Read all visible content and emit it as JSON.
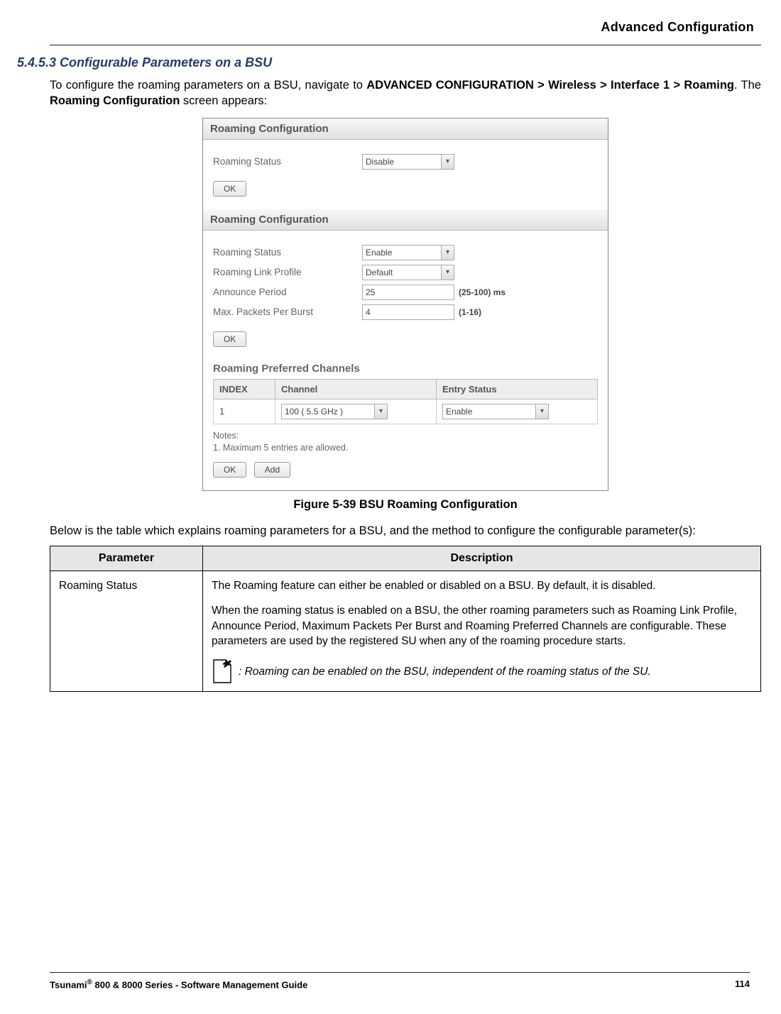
{
  "header": {
    "right": "Advanced Configuration"
  },
  "section": {
    "heading": "5.4.5.3 Configurable Parameters on a BSU"
  },
  "intro": {
    "pre": "To configure the roaming parameters on a BSU, navigate to ",
    "path": "ADVANCED CONFIGURATION > Wireless > Interface 1 > Roaming",
    "mid": ". The ",
    "screen": "Roaming Configuration",
    "post": " screen appears:"
  },
  "ui": {
    "panel1": {
      "title": "Roaming Configuration",
      "roamingStatusLabel": "Roaming Status",
      "roamingStatusValue": "Disable",
      "ok": "OK"
    },
    "panel2": {
      "title": "Roaming Configuration",
      "rows": {
        "roamingStatus": {
          "label": "Roaming Status",
          "value": "Enable"
        },
        "linkProfile": {
          "label": "Roaming Link Profile",
          "value": "Default"
        },
        "announce": {
          "label": "Announce Period",
          "value": "25",
          "hint": "(25-100) ms"
        },
        "maxPackets": {
          "label": "Max. Packets Per Burst",
          "value": "4",
          "hint": "(1-16)"
        }
      },
      "ok": "OK",
      "preferred": {
        "title": "Roaming Preferred Channels",
        "headers": {
          "index": "INDEX",
          "channel": "Channel",
          "entry": "Entry Status"
        },
        "row": {
          "index": "1",
          "channel": "100 ( 5.5 GHz )",
          "entry": "Enable"
        },
        "notesTitle": "Notes:",
        "note1": "1. Maximum 5 entries are allowed.",
        "ok": "OK",
        "add": "Add"
      }
    }
  },
  "figcap": "Figure 5-39 BSU Roaming Configuration",
  "tableIntro": "Below is the table which explains roaming parameters for a BSU, and the method to configure the configurable parameter(s):",
  "paramTable": {
    "headers": {
      "param": "Parameter",
      "desc": "Description"
    },
    "row1": {
      "param": "Roaming Status",
      "p1": "The Roaming feature can either be enabled or disabled on a BSU. By default, it is disabled.",
      "p2": "When the roaming status is enabled on a BSU, the other roaming parameters such as Roaming Link Profile, Announce Period, Maximum Packets Per Burst and Roaming Preferred Channels are configurable. These parameters are used by the registered SU when any of the roaming procedure starts.",
      "note": ": Roaming can be enabled on the BSU, independent of the roaming status of the SU."
    }
  },
  "footer": {
    "left": "Tsunami® 800 & 8000 Series - Software Management Guide",
    "left_pre": "Tsunami",
    "left_reg": "®",
    "left_post": " 800 & 8000 Series - Software Management Guide",
    "page": "114"
  }
}
